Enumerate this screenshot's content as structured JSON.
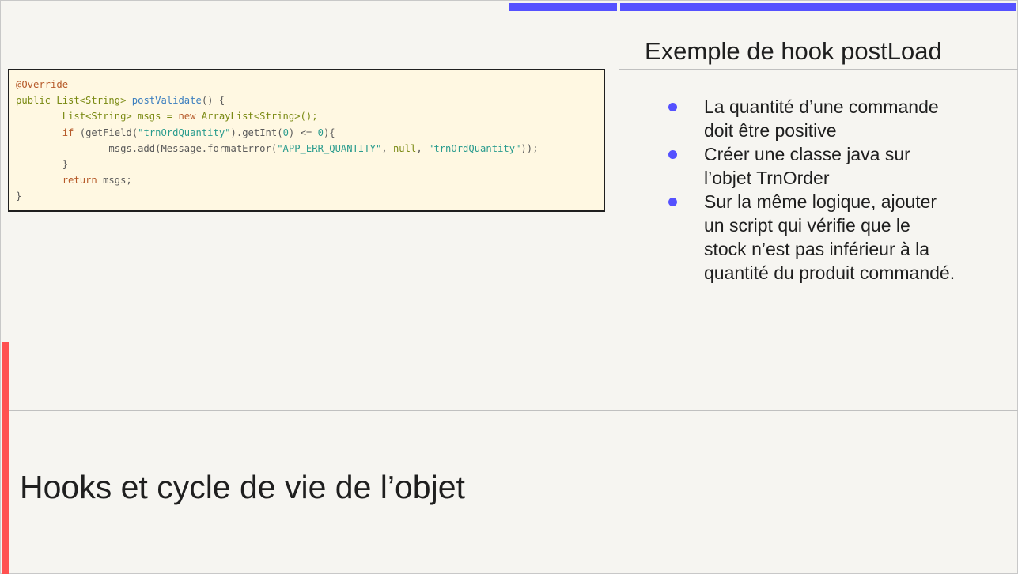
{
  "slide": {
    "main_title": "Hooks et cycle de vie de l’objet",
    "right_title": "Exemple de hook postLoad",
    "bullets": [
      "La quantité d’une commande doit être positive",
      "Créer une classe java sur l’objet TrnOrder",
      "Sur la même logique, ajouter un script qui vérifie que le stock n’est pas inférieur à la quantité du produit commandé."
    ],
    "code": {
      "line1": {
        "annotation": "@Override"
      },
      "line2": {
        "kw_public": "public",
        "type": " List<String> ",
        "method": "postValidate",
        "rest": "() {"
      },
      "line3": {
        "indent": "        ",
        "decl": "List<String> msgs = ",
        "kw_new": "new",
        "rest": " ArrayList<String>();"
      },
      "line4": {
        "indent": "        ",
        "kw_if": "if",
        "pre": " (getField(",
        "str": "\"trnOrdQuantity\"",
        "mid": ").getInt(",
        "num0": "0",
        "cmp": ") <= ",
        "num1": "0",
        "end": "){"
      },
      "line5": {
        "indent": "                ",
        "pre": "msgs.add(Message.formatError(",
        "str1": "\"APP_ERR_QUANTITY\"",
        "sep1": ", ",
        "kw_null": "null",
        "sep2": ", ",
        "str2": "\"trnOrdQuantity\"",
        "end": "));"
      },
      "line6": {
        "indent": "        ",
        "text": "}"
      },
      "line7": {
        "indent": "        ",
        "kw_return": "return",
        "rest": " msgs;"
      },
      "line8": {
        "text": "}"
      }
    },
    "colors": {
      "accent_blue": "#5551ff",
      "accent_red": "#ff5050",
      "background": "#f6f5f1",
      "code_background": "#fff8e2"
    }
  }
}
